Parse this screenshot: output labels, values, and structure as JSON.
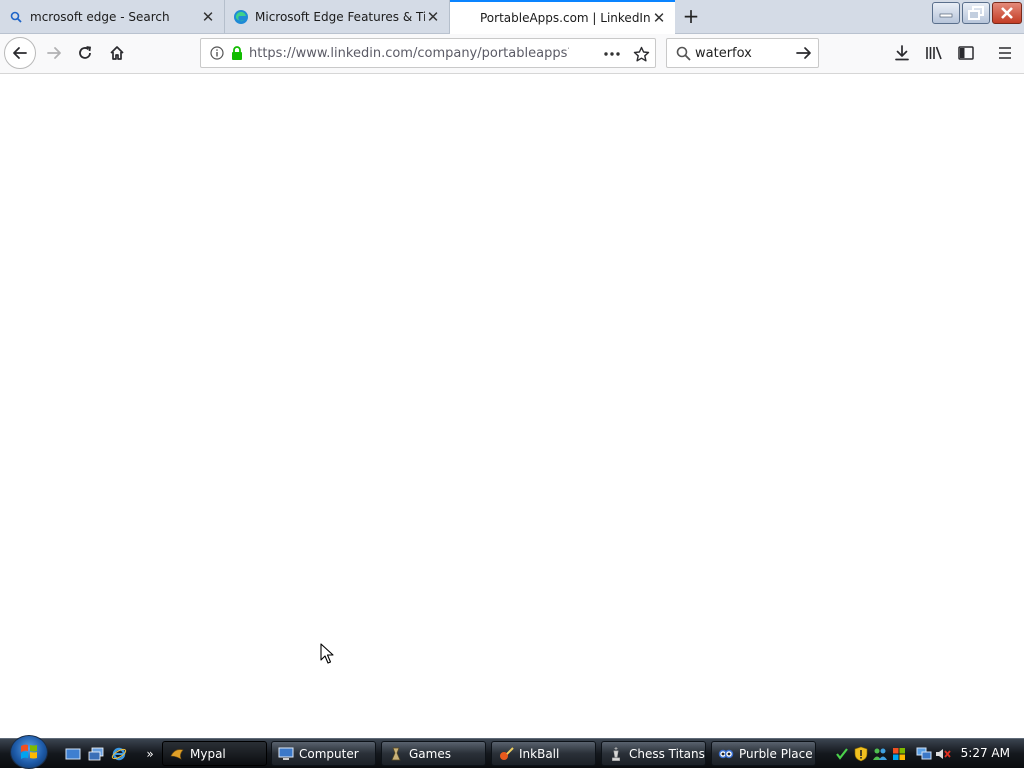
{
  "browser": {
    "tabs": [
      {
        "title": "mcrosoft edge - Search",
        "favicon": "search-icon",
        "active": false
      },
      {
        "title": "Microsoft Edge Features & Tips",
        "favicon": "edge-icon",
        "active": false
      },
      {
        "title": "PortableApps.com | LinkedIn",
        "favicon": "",
        "active": true
      }
    ],
    "url": "https://www.linkedin.com/company/portableapps?o",
    "search_value": "waterfox"
  },
  "taskbar": {
    "buttons": [
      {
        "label": "Mypal",
        "icon": "mypal-icon",
        "active": true
      },
      {
        "label": "Computer",
        "icon": "computer-icon",
        "active": false
      },
      {
        "label": "Games",
        "icon": "games-icon",
        "active": false
      },
      {
        "label": "InkBall",
        "icon": "inkball-icon",
        "active": false
      },
      {
        "label": "Chess Titans",
        "icon": "chess-icon",
        "active": false
      },
      {
        "label": "Purble Place",
        "icon": "purble-icon",
        "active": false
      }
    ],
    "clock": "5:27 AM"
  },
  "colors": {
    "accent": "#0a84ff",
    "lock_green": "#12bc00"
  }
}
